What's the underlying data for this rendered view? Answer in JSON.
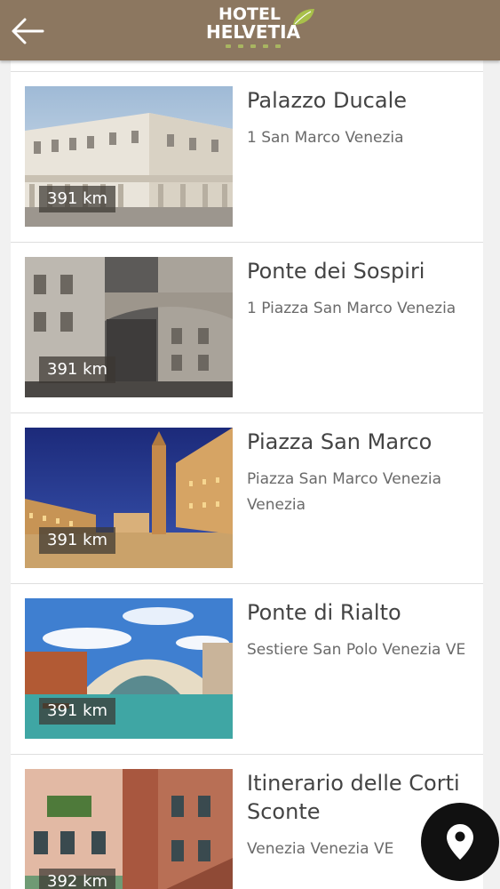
{
  "header": {
    "back_icon": "arrow-left-icon",
    "logo_line1": "HOTEL",
    "logo_line2": "HELVETIA",
    "logo_icon": "leaf-icon",
    "background": "#8c7760"
  },
  "places": [
    {
      "name": "Palazzo Ducale",
      "address": "1 San Marco Venezia",
      "distance": "391 km"
    },
    {
      "name": "Ponte dei Sospiri",
      "address": "1 Piazza San Marco Venezia",
      "distance": "391 km"
    },
    {
      "name": "Piazza San Marco",
      "address": "Piazza San Marco Venezia Venezia",
      "distance": "391 km"
    },
    {
      "name": "Ponte di Rialto",
      "address": "Sestiere San Polo Venezia VE",
      "distance": "391 km"
    },
    {
      "name": "Itinerario delle Corti Sconte",
      "address": "Venezia Venezia VE",
      "distance": "392 km"
    }
  ],
  "fab": {
    "icon": "map-pin-icon"
  }
}
